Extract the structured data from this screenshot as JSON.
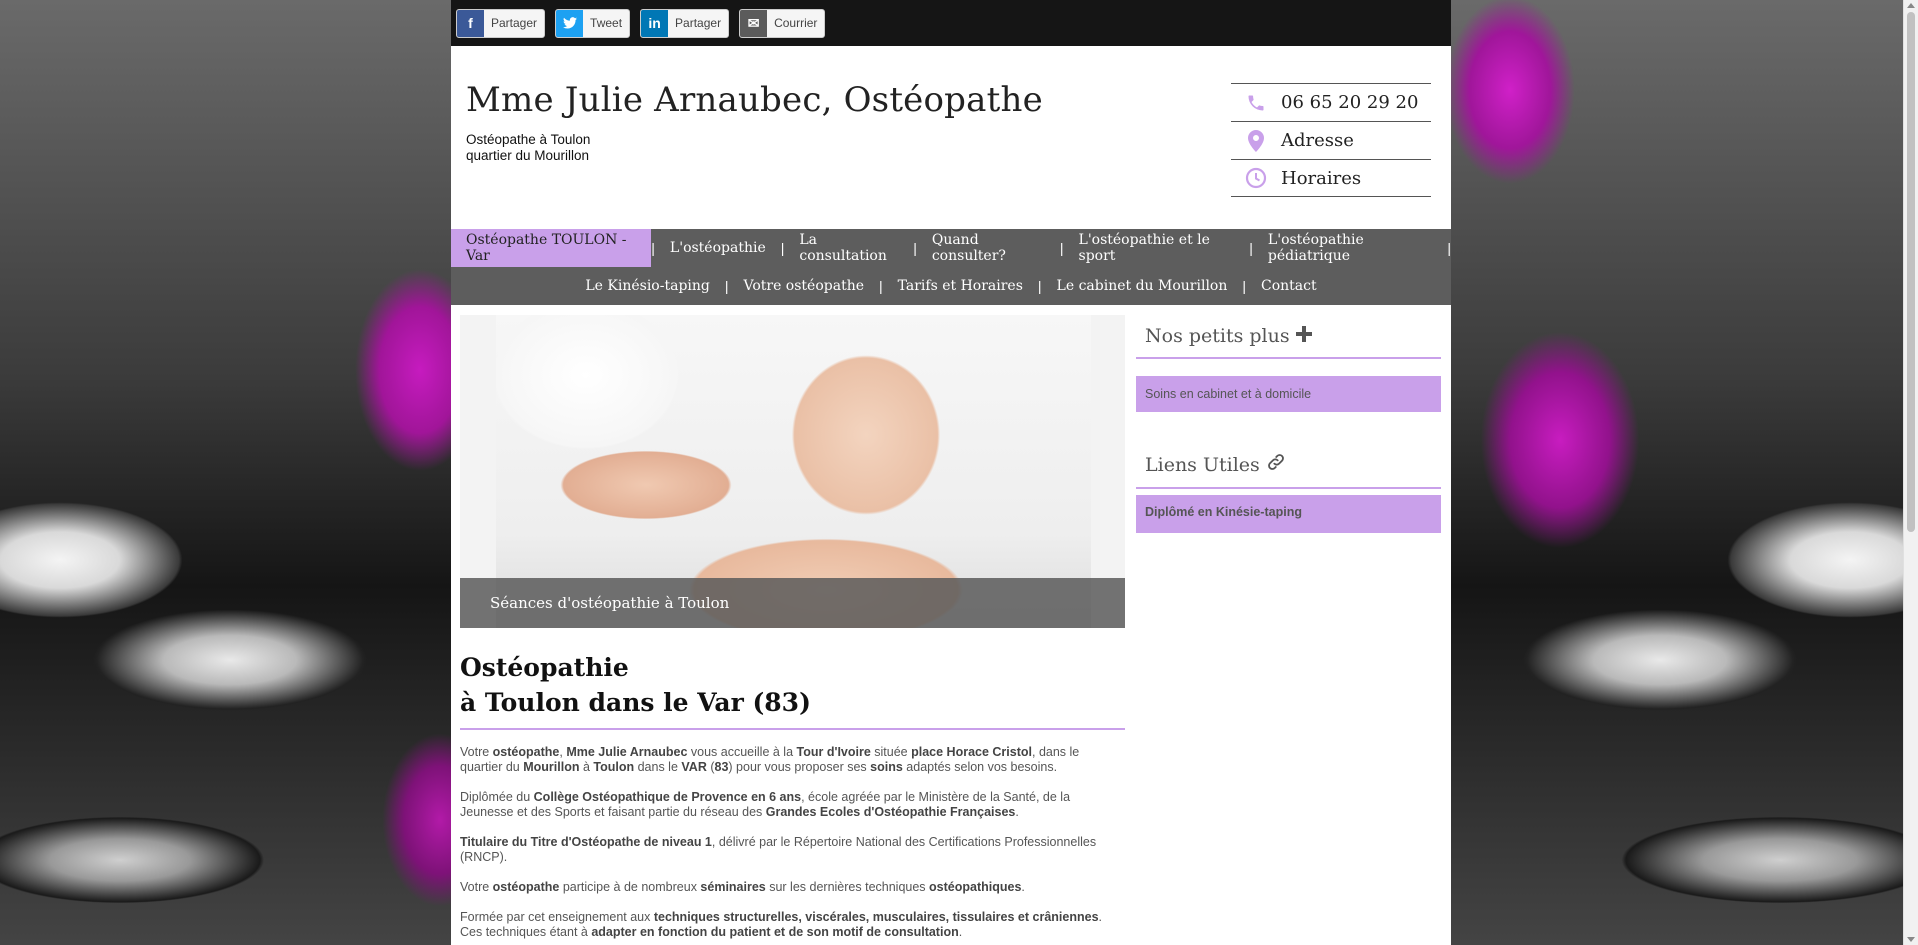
{
  "share": {
    "items": [
      {
        "label": "Partager",
        "icon": "facebook-icon",
        "glyph": "f"
      },
      {
        "label": "Tweet",
        "icon": "twitter-icon",
        "glyph": "t"
      },
      {
        "label": "Partager",
        "icon": "linkedin-icon",
        "glyph": "in"
      },
      {
        "label": "Courrier",
        "icon": "mail-icon",
        "glyph": "✉"
      }
    ]
  },
  "header": {
    "title": "Mme Julie Arnaubec, Ostéopathe",
    "subtitle_line1": "Ostéopathe à Toulon",
    "subtitle_line2": "quartier du Mourillon"
  },
  "contact": {
    "phone": "06 65 20 29 20",
    "address": "Adresse",
    "hours": "Horaires"
  },
  "nav": {
    "row1": [
      "Ostéopathe TOULON - Var",
      "L'ostéopathie",
      "La consultation",
      "Quand consulter?",
      "L'ostéopathie et le sport",
      "L'ostéopathie pédiatrique"
    ],
    "row2": [
      "Le Kinésio-taping",
      "Votre ostéopathe",
      "Tarifs et Horaires",
      "Le cabinet du Mourillon",
      "Contact"
    ]
  },
  "hero": {
    "caption": "Séances d'ostéopathie à Toulon"
  },
  "main": {
    "heading_line1": "Ostéopathie",
    "heading_line2": "à Toulon dans le Var (83)"
  },
  "sidebar": {
    "section1_title": "Nos petits plus",
    "section1_item": "Soins en cabinet et à domicile",
    "section2_title": "Liens Utiles",
    "section2_item": "Diplômé en Kinésie-taping"
  },
  "colors": {
    "accent": "#c9a0ea",
    "nav_bg": "#5d5d5d",
    "share_bar_bg": "#151515"
  }
}
